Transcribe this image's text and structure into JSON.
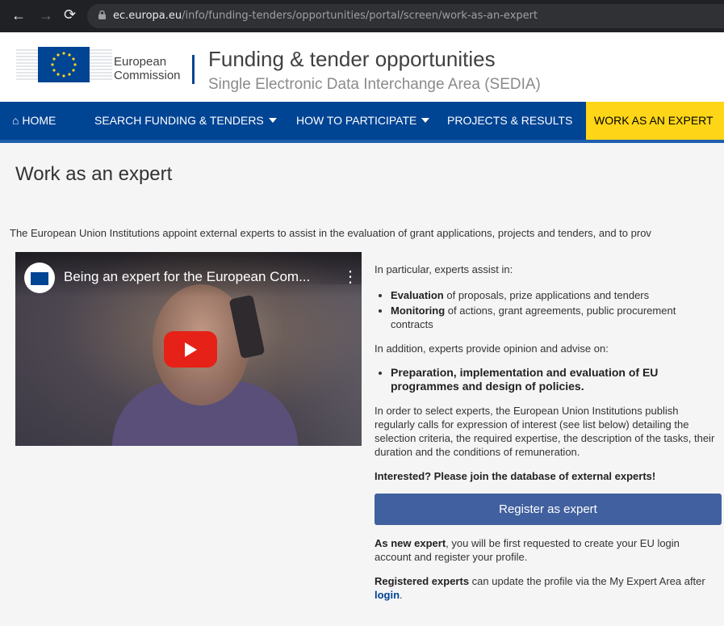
{
  "browser": {
    "url_host": "ec.europa.eu",
    "url_path": "/info/funding-tenders/opportunities/portal/screen/work-as-an-expert"
  },
  "header": {
    "logo_line1": "European",
    "logo_line2": "Commission",
    "title": "Funding & tender opportunities",
    "subtitle": "Single Electronic Data Interchange Area (SEDIA)"
  },
  "menu": {
    "home": "HOME",
    "search": "SEARCH FUNDING & TENDERS",
    "how": "HOW TO PARTICIPATE",
    "projects": "PROJECTS & RESULTS",
    "expert": "WORK AS AN EXPERT"
  },
  "page": {
    "title": "Work as an expert",
    "intro": "The European Union Institutions appoint external experts to assist in the evaluation of grant applications, projects and tenders, and to prov"
  },
  "video": {
    "title": "Being an expert for the European Com..."
  },
  "content": {
    "assist_intro": "In particular, experts assist in:",
    "item1_bold": "Evaluation",
    "item1_rest": " of proposals, prize applications and tenders",
    "item2_bold": "Monitoring",
    "item2_rest": " of actions, grant agreements, public procurement contracts",
    "advise_intro": "In addition, experts provide opinion and advise on:",
    "item3_bold": "Preparation, implementation and evaluation of EU programmes and design of policies.",
    "select_text": "In order to select experts, the European Union Institutions publish regularly calls for expression of interest (see list below) detailing the selection criteria, the required expertise, the description of the tasks, their duration and the conditions of remuneration.",
    "interested": "Interested? Please join the database of external experts!",
    "register_button": "Register as expert",
    "new_expert_bold": "As new expert",
    "new_expert_rest": ", you will be first requested to create your EU login account and register your profile.",
    "registered_bold": "Registered experts",
    "registered_rest": " can update the profile via the My Expert Area after ",
    "login_link": "login",
    "period": "."
  }
}
